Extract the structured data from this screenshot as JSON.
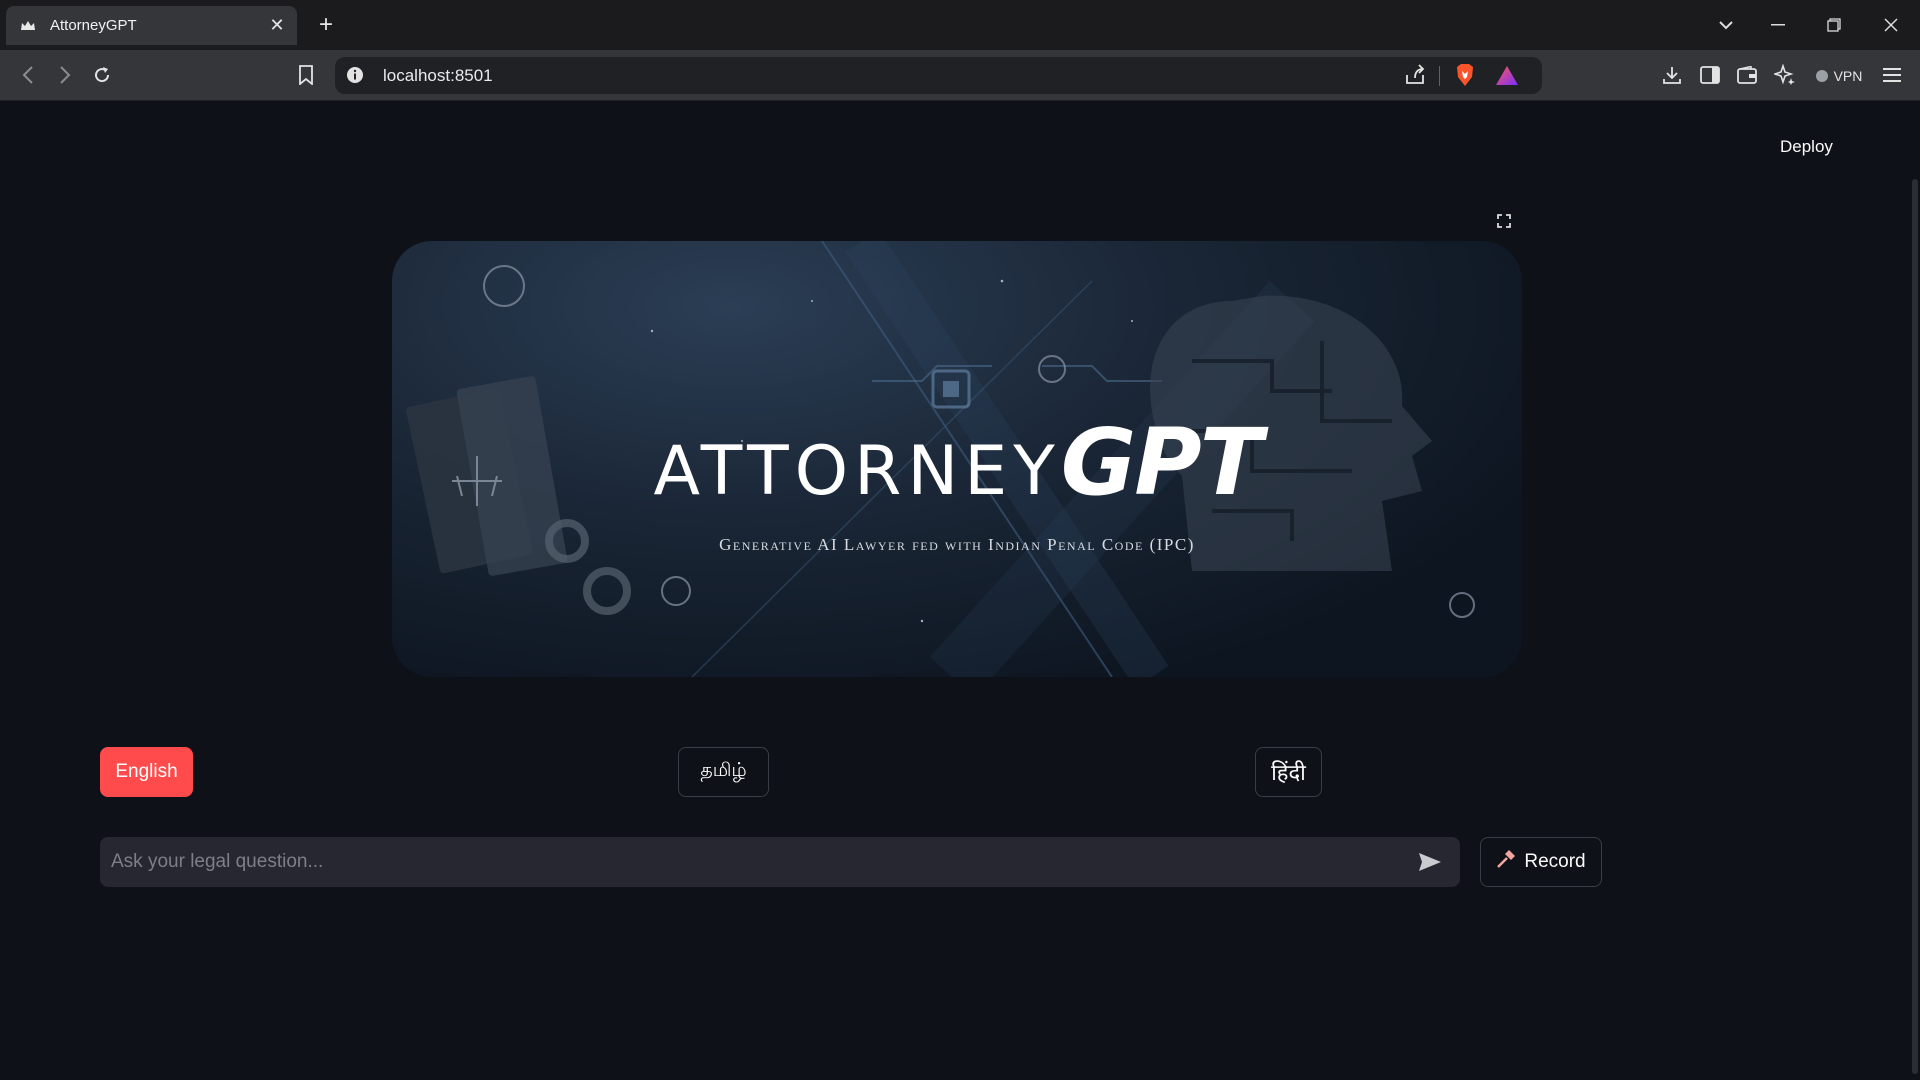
{
  "browser": {
    "tab_title": "AttorneyGPT",
    "tab_close": "✕",
    "new_tab": "+",
    "url": "localhost:8501",
    "vpn_label": "VPN"
  },
  "app": {
    "deploy_label": "Deploy",
    "banner": {
      "brand_light": "ATTORNEY",
      "brand_bold": "GPT",
      "tagline": "Generative  AI Lawyer fed with Indian Penal Code (IPC)"
    },
    "languages": [
      "English",
      "தமிழ்",
      "हिंदी"
    ],
    "selected_language": "English",
    "chat": {
      "placeholder": "Ask your legal question...",
      "value": ""
    },
    "record_label": "Record"
  },
  "colors": {
    "accent": "#ff4b4b",
    "background": "#0e1117",
    "input_bg": "#262730"
  }
}
